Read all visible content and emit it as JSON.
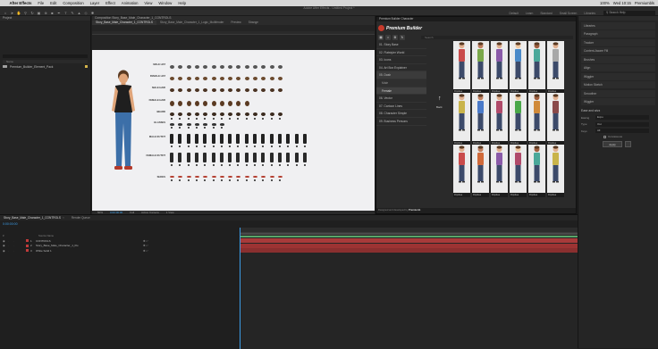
{
  "menubar": {
    "items": [
      "After Effects",
      "File",
      "Edit",
      "Composition",
      "Layer",
      "Effect",
      "Animation",
      "View",
      "Window",
      "Help"
    ],
    "status": [
      "100%",
      "Wed 10:15",
      "Premiumbls"
    ]
  },
  "app_title": "Adobe After Effects - Untitled Project *",
  "toolbar": {
    "workspaces": [
      "Default",
      "Learn",
      "Standard",
      "Small Screen",
      "Libraries"
    ],
    "search_help": "Search Help"
  },
  "project_panel": {
    "title": "Project",
    "column_header": "Name",
    "item": "Premium_Builder_Element_Pack"
  },
  "composition": {
    "header": "Composition Story_Base_Male_Character_1_CONTROLS",
    "tabs": [
      "Story_Base_Male_Character_1_CONTROLS",
      "Story_Base_Male_Character_1_Logic_Multifender"
    ],
    "other_tabs": [
      "Preview",
      "Strange"
    ],
    "row_labels": [
      "MALE HAT",
      "FEMALE HAT",
      "MALE HAIR",
      "FEMALE HAIR",
      "BEARD",
      "GLASSES",
      "MALE OUTFIT",
      "FEMALE OUTFIT",
      "SHOES"
    ],
    "footer": {
      "zoom": "50%",
      "time": "0:00:00:00",
      "quality": "Full",
      "camera": "Active Camera",
      "views": "1 View"
    }
  },
  "premium_builder": {
    "panel_title": "Premium Builder Character",
    "brand": "Premium Builder",
    "search_placeholder": "Search",
    "menu": [
      {
        "label": "01. Story Base",
        "state": "normal"
      },
      {
        "label": "02. Flatstyler World",
        "state": "normal"
      },
      {
        "label": "03. Icons",
        "state": "normal"
      },
      {
        "label": "04. Art Box Explainer",
        "state": "normal"
      },
      {
        "label": "05. Dash",
        "state": "selected"
      },
      {
        "label": "Male",
        "state": "sub"
      },
      {
        "label": "Female",
        "state": "subselected"
      },
      {
        "label": "06. Vector",
        "state": "normal"
      },
      {
        "label": "07. Cartoon Lines",
        "state": "normal"
      },
      {
        "label": "08. Character Simple",
        "state": "normal"
      },
      {
        "label": "09. Business Persons",
        "state": "normal"
      }
    ],
    "back_label": "Back",
    "thumb_label": "Flipidea",
    "thumbs_count": 18,
    "footer_text": "Designed and developed by",
    "footer_brand": "Premiumb"
  },
  "right_panel": {
    "items": [
      "Libraries",
      "Paragraph",
      "Tracker",
      "Content-Aware Fill",
      "Brushes",
      "Align",
      "Wiggler",
      "Motion Sketch",
      "Smoother",
      "Wiggler"
    ],
    "section": "Ease and wizz",
    "fields": [
      {
        "label": "Easing",
        "value": "Expo"
      },
      {
        "label": "Type",
        "value": "Out"
      },
      {
        "label": "Keys",
        "value": "All"
      }
    ],
    "check": "Curvaceous",
    "apply": "Apply"
  },
  "timeline": {
    "tabs": [
      "Story_Base_Male_Character_1_CONTROLS",
      "Render Queue"
    ],
    "time": "0:00:00:00",
    "columns": [
      "#",
      "Source Name"
    ],
    "layers": [
      {
        "num": "1",
        "name": "CONTROLS",
        "chip": "#c23b3b",
        "bar": "#a83a3a"
      },
      {
        "num": "2",
        "name": "Story_Base_Male_Character_1_Illu",
        "chip": "#c23b3b",
        "bar": "#9c3333"
      },
      {
        "num": "3",
        "name": "White Solid 1",
        "chip": "#c23b3b",
        "bar": "#8a2f2f"
      }
    ]
  },
  "colors": {
    "accent_blue": "#3b9ce7",
    "brand_red": "#c83a2b",
    "timeline_green": "#5aa469"
  }
}
